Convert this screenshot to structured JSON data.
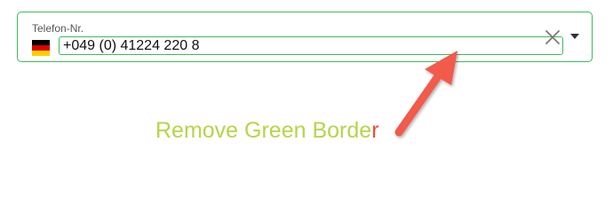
{
  "phone_field": {
    "label": "Telefon-Nr.",
    "value": "+049 (0) 41224 220 8",
    "country_flag_icon": "germany-flag-icon",
    "flag_colors": [
      "#000000",
      "#dd0000",
      "#ffce00"
    ],
    "clear_icon": "close-icon",
    "dropdown_icon": "caret-down-icon",
    "border_color": "#3dba5c"
  },
  "annotation": {
    "text_main": "Remove Green Borde",
    "text_tail": "r",
    "text_main_color": "#b5d54a",
    "text_tail_color": "#f04b3c",
    "arrow_color": "#f25a4b"
  }
}
